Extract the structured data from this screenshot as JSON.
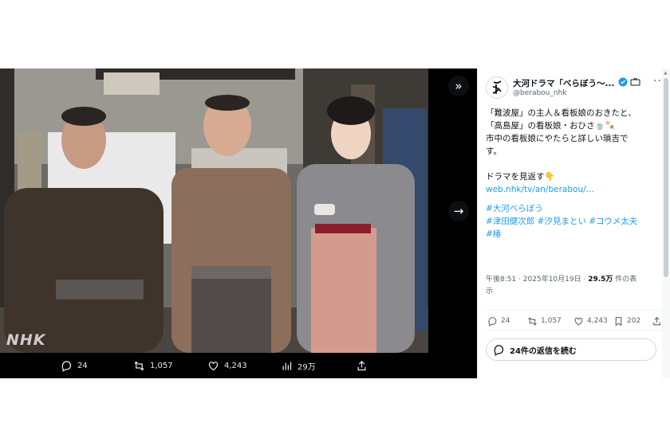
{
  "media": {
    "watermark": "NHK",
    "actions": {
      "replies": "24",
      "reposts": "1,057",
      "likes": "4,243",
      "views": "29万"
    }
  },
  "tweet": {
    "display_name": "大河ドラマ「べらぼう～...",
    "handle": "@berabou_nhk",
    "lines": [
      "「難波屋」の主人＆看板娘のおきたと、",
      "「高島屋」の看板娘・おひさ🍵🍡",
      "市中の看板娘にやたらと詳しい瑣吉で",
      "す。",
      "",
      "ドラマを見返す👇"
    ],
    "link": "web.nhk/tv/an/berabou/...",
    "hashtags_line1": "#大河べらぼう",
    "hashtags_line2": [
      "#津田健次郎",
      "#汐見まとい",
      "#コウメ太夫"
    ],
    "hashtags_line3": "#椿",
    "time": "午後8:51 · 2025年10月19日 · ",
    "views_number": "29.5万",
    "views_suffix": " 件の表",
    "views_suffix2": "示",
    "stats": {
      "replies": "24",
      "reposts": "1,057",
      "likes": "4,243",
      "bookmarks": "202"
    },
    "read_replies": "24件の返信を読む"
  },
  "colors": {
    "accent": "#1d9bf0",
    "text": "#0f1419",
    "muted": "#536471"
  }
}
